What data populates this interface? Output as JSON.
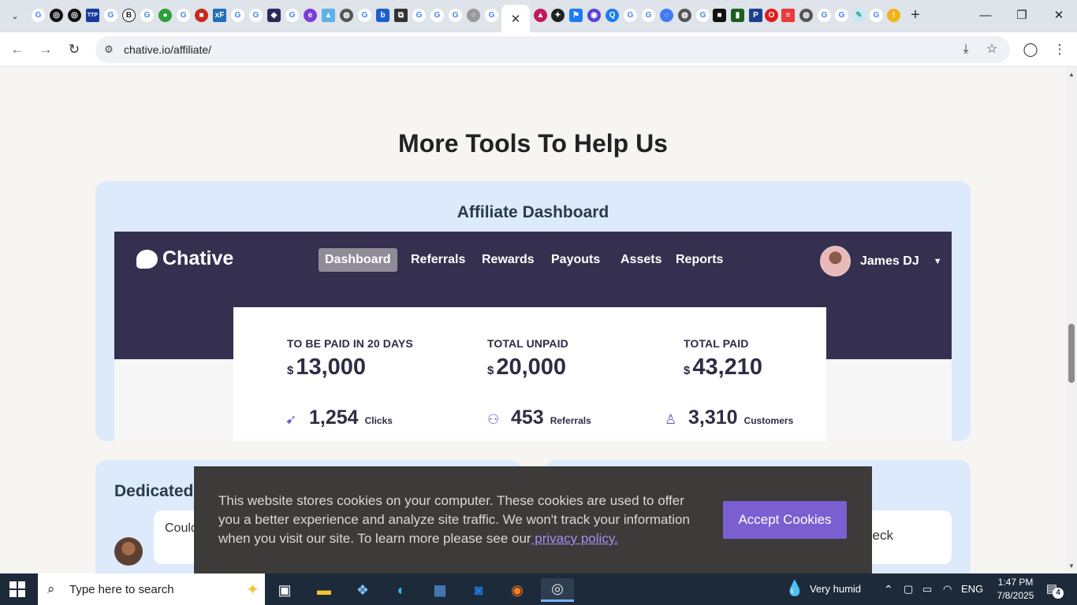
{
  "browser": {
    "active_tab_close": "✕",
    "new_tab": "+",
    "window_controls": {
      "minimize": "—",
      "maximize": "❐",
      "close": "✕"
    },
    "url": "chative.io/affiliate/"
  },
  "page": {
    "section_title": "More Tools To Help Us",
    "dashboard_card_title": "Affiliate Dashboard",
    "dashboard": {
      "brand": "Chative",
      "nav": [
        "Dashboard",
        "Referrals",
        "Rewards",
        "Payouts",
        "Assets",
        "Reports"
      ],
      "active_nav": "Dashboard",
      "user_name": "James DJ",
      "stats": [
        {
          "label": "TO BE PAID IN 20 DAYS",
          "currency": "$",
          "value": "13,000"
        },
        {
          "label": "TOTAL UNPAID",
          "currency": "$",
          "value": "20,000"
        },
        {
          "label": "TOTAL PAID",
          "currency": "$",
          "value": "43,210"
        }
      ],
      "metrics": [
        {
          "icon": "cursor-click-icon",
          "value": "1,254",
          "label": "Clicks"
        },
        {
          "icon": "users-icon",
          "value": "453",
          "label": "Referrals"
        },
        {
          "icon": "user-icon",
          "value": "3,310",
          "label": "Customers"
        }
      ]
    },
    "dedicated_title": "Dedicated",
    "chat_preview": "Coulc AI Ag",
    "right_preview": "Deck"
  },
  "cookie_banner": {
    "text": "This website stores cookies on your computer. These cookies are used to offer you a better experience and analyze site traffic. We won't track your information when you visit our site. To learn more please see our",
    "link": " privacy policy.",
    "button": "Accept Cookies"
  },
  "taskbar": {
    "search_placeholder": "Type here to search",
    "weather": "Very humid",
    "language": "ENG",
    "time": "1:47 PM",
    "date": "7/8/2025",
    "notifications": "4"
  },
  "colors": {
    "dashboard_header": "#35304f",
    "card_bg": "#dceafc",
    "accent_purple": "#7b5fd1",
    "cookie_bg": "#3c3b39"
  }
}
